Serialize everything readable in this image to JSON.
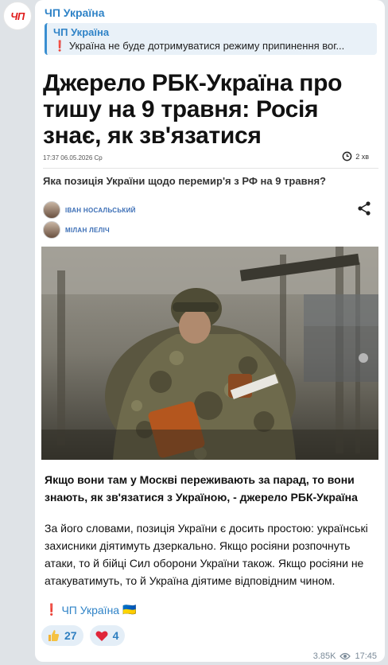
{
  "channel": {
    "avatar_text": "ЧП",
    "name": "ЧП Україна"
  },
  "reply_quote": {
    "title": "ЧП Україна",
    "mark": "❗",
    "text": "Україна не буде дотримуватися режиму припинення вог..."
  },
  "article": {
    "headline": "Джерело РБК-Україна про тишу на 9 травня: Росія знає, як зв'язатися",
    "datetime": "17:37 06.05.2026 Ср",
    "read_time": "2 хв",
    "subheadline": "Яка позиція України щодо перемир'я з РФ на 9 травня?",
    "authors": [
      "ІВАН НОСАЛЬСЬКИЙ",
      "МІЛАН ЛЕЛІЧ"
    ]
  },
  "message": {
    "caption": "Якщо вони там у Москві переживають за парад, то вони знають, як зв'язатися з Україною, - джерело РБК-Україна",
    "body": "За його словами, позиція України є досить простою: українські захисники діятимуть дзеркально. Якщо росіяни розпочнуть атаки, то й бійці Сил оборони України також. Якщо росіяни не атакуватимуть, то й Україна діятиме відповідним чином.",
    "signature_mark": "❗",
    "signature": "ЧП Україна",
    "signature_flag": "🇺🇦"
  },
  "reactions": [
    {
      "icon": "thumbs-up-icon",
      "count": "27"
    },
    {
      "icon": "heart-icon",
      "count": "4"
    }
  ],
  "footer": {
    "views": "3.85K",
    "time": "17:45"
  },
  "colors": {
    "accent": "#2f83c7",
    "brand_red": "#e01b1b",
    "chat_background": "#dfe3e7"
  }
}
